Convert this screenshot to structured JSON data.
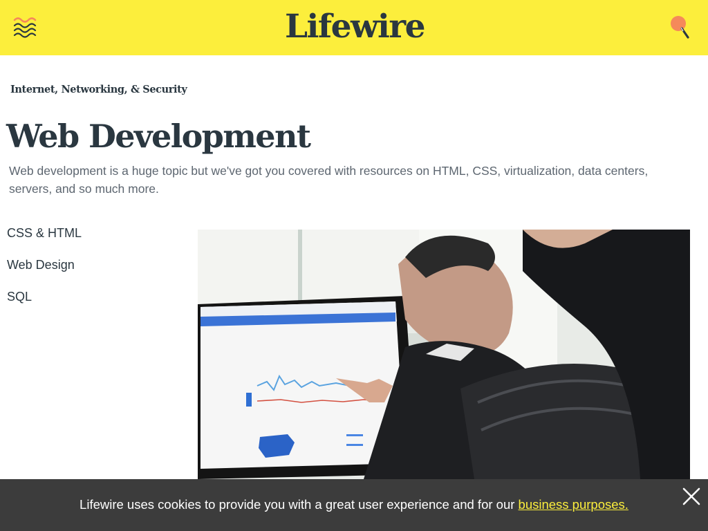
{
  "header": {
    "logo_text": "Lifewire",
    "menu_icon": "wavy-lines-menu-icon",
    "search_icon": "magnifier-search-icon",
    "background_color": "#fcee3c",
    "accent_color": "#f5895a"
  },
  "breadcrumb": {
    "label": "Internet, Networking, & Security"
  },
  "page": {
    "title": "Web Development",
    "description": "Web development is a huge topic but we've got you covered with resources on HTML, CSS, virtualization, data centers, servers, and so much more."
  },
  "subnav": {
    "items": [
      {
        "label": "CSS & HTML"
      },
      {
        "label": "Web Design"
      },
      {
        "label": "SQL"
      }
    ]
  },
  "hero": {
    "image_alt": "Two people looking at web analytics chart on a computer monitor"
  },
  "cookie_banner": {
    "text": "Lifewire uses cookies to provide you with a great user experience and for our ",
    "link_label": "business purposes.",
    "close_icon": "close-icon",
    "background_color": "#3c3c3c",
    "link_color": "#fcee3c"
  }
}
